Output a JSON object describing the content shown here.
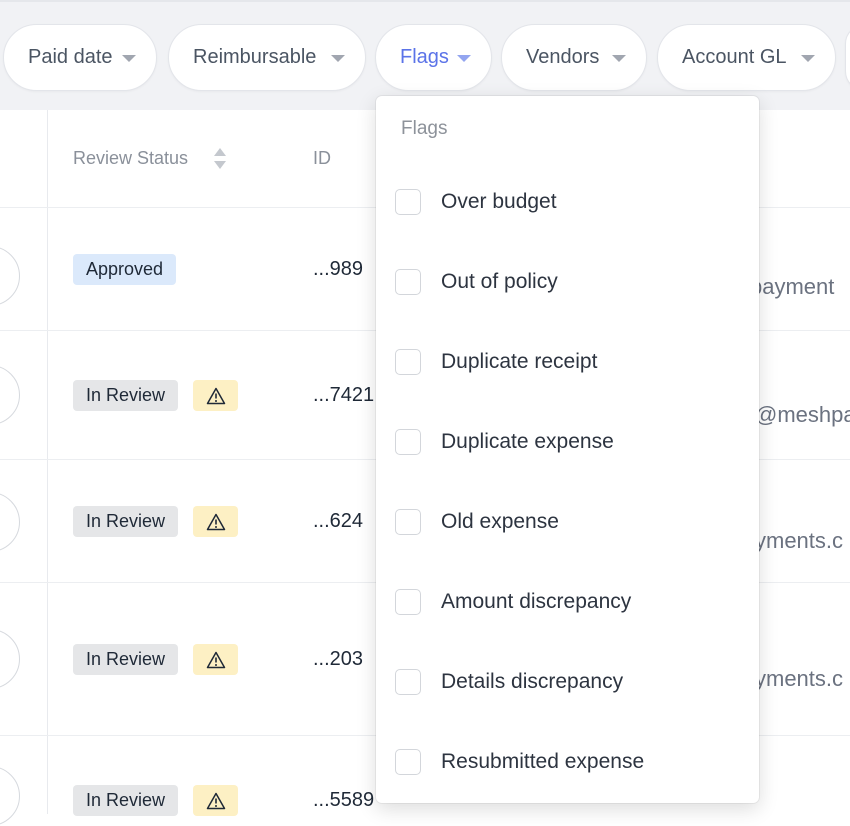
{
  "filters": [
    {
      "label": "Paid date",
      "active": false
    },
    {
      "label": "Reimbursable",
      "active": false
    },
    {
      "label": "Flags",
      "active": true
    },
    {
      "label": "Vendors",
      "active": false
    },
    {
      "label": "Account GL",
      "active": false
    }
  ],
  "table": {
    "columns": {
      "review_status": "Review Status",
      "id": "ID"
    },
    "rows": [
      {
        "status": "Approved",
        "status_type": "approved",
        "flag_icon": false,
        "id": "...989",
        "email_fragment": "payment"
      },
      {
        "status": "In Review",
        "status_type": "review",
        "flag_icon": true,
        "id": "...7421",
        "email_fragment": "@meshpa"
      },
      {
        "status": "In Review",
        "status_type": "review",
        "flag_icon": true,
        "id": "...624",
        "email_fragment": "yments.c"
      },
      {
        "status": "In Review",
        "status_type": "review",
        "flag_icon": true,
        "id": "...203",
        "email_fragment": "yments.c"
      },
      {
        "status": "In Review",
        "status_type": "review",
        "flag_icon": true,
        "id": "...5589",
        "email_fragment": ""
      }
    ]
  },
  "flags_dropdown": {
    "title": "Flags",
    "options": [
      {
        "label": "Over budget",
        "checked": false
      },
      {
        "label": "Out of policy",
        "checked": false
      },
      {
        "label": "Duplicate receipt",
        "checked": false
      },
      {
        "label": "Duplicate expense",
        "checked": false
      },
      {
        "label": "Old expense",
        "checked": false
      },
      {
        "label": "Amount discrepancy",
        "checked": false
      },
      {
        "label": "Details discrepancy",
        "checked": false
      },
      {
        "label": "Resubmitted expense",
        "checked": false
      }
    ]
  },
  "colors": {
    "accent": "#5b73e8",
    "approved_bg": "#dbe9fb",
    "review_bg": "#e5e6e8",
    "warning_bg": "#fdf0c4"
  }
}
